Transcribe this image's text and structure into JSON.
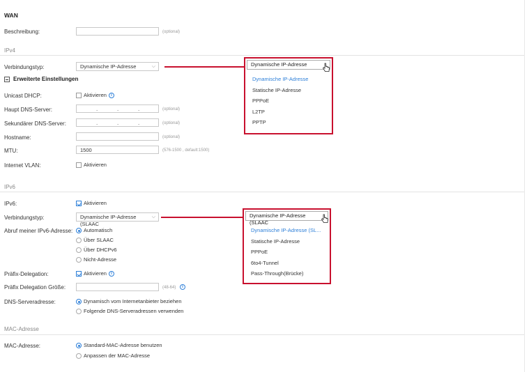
{
  "page": {
    "title": "WAN",
    "description_label": "Beschreibung:",
    "description_hint": "(optional)"
  },
  "ipv4": {
    "section": "IPv4",
    "conn_type_label": "Verbindungstyp:",
    "conn_type_value": "Dynamische IP-Adresse",
    "advanced_label": "Erweiterte Einstellungen",
    "unicast_label": "Unicast DHCP:",
    "unicast_option": "Aktivieren",
    "primary_dns_label": "Haupt DNS-Server:",
    "primary_dns_hint": "(optional)",
    "secondary_dns_label": "Sekundärer DNS-Server:",
    "secondary_dns_hint": "(optional)",
    "hostname_label": "Hostname:",
    "hostname_hint": "(optional)",
    "mtu_label": "MTU:",
    "mtu_value": "1500",
    "mtu_hint": "(576-1500 , default:1500)",
    "vlan_label": "Internet VLAN:",
    "vlan_option": "Aktivieren",
    "dropdown_selected": "Dynamische IP-Adresse",
    "dropdown_options": [
      "Dynamische IP-Adresse",
      "Statische IP-Adresse",
      "PPPoE",
      "L2TP",
      "PPTP"
    ]
  },
  "ipv6": {
    "section": "IPv6",
    "ipv6_label": "IPv6:",
    "ipv6_option": "Aktivieren",
    "conn_type_label": "Verbindungstyp:",
    "conn_type_value": "Dynamische IP-Adresse (SLAAC",
    "get_addr_label": "Abruf meiner IPv6-Adresse:",
    "get_addr_options": [
      "Automatisch",
      "Über SLAAC",
      "Über DHCPv6",
      "Nicht-Adresse"
    ],
    "prefix_label": "Präfix-Delegation:",
    "prefix_option": "Aktivieren",
    "prefix_size_label": "Präfix Delegation Größe:",
    "prefix_size_hint": "(48-64)",
    "dns_label": "DNS-Serveradresse:",
    "dns_options": [
      "Dynamisch vom Internetanbieter beziehen",
      "Folgende DNS-Serveradressen verwenden"
    ],
    "dropdown_selected": "Dynamische IP-Adresse (SLAAC",
    "dropdown_options": [
      "Dynamische IP-Adresse (SL...",
      "Statische IP-Adresse",
      "PPPoE",
      "6to4-Tunnel",
      "Pass-Through(Brücke)"
    ]
  },
  "mac": {
    "section": "MAC-Adresse",
    "label": "MAC-Adresse:",
    "options": [
      "Standard-MAC-Adresse benutzen",
      "Anpassen der MAC-Adresse"
    ]
  },
  "colors": {
    "accent": "#2d7fd8",
    "highlight": "#c8102e"
  },
  "icons": {
    "info": "info-icon",
    "cursor": "hand-cursor-icon",
    "chevron": "chevron-down-icon",
    "collapse": "minus-box-icon"
  }
}
